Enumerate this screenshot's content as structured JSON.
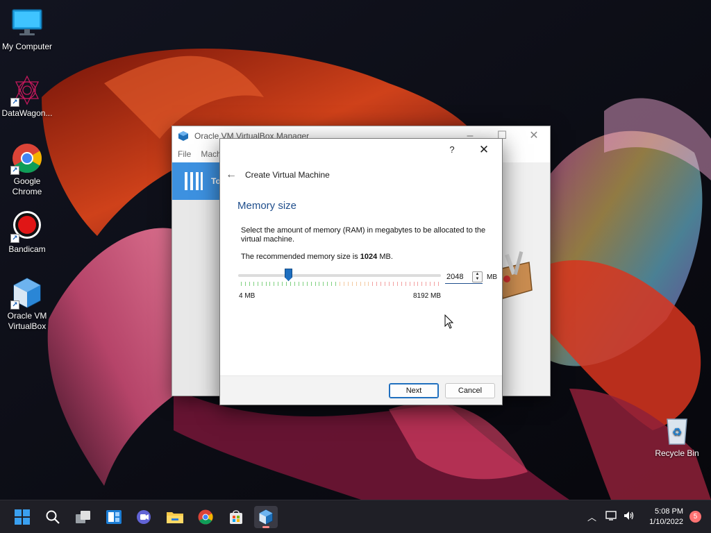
{
  "desktop": {
    "icons": [
      {
        "label": "My Computer"
      },
      {
        "label": "DataWagon..."
      },
      {
        "label": "Google Chrome"
      },
      {
        "label": "Bandicam"
      },
      {
        "label": "Oracle VM VirtualBox"
      },
      {
        "label": "Recycle Bin"
      }
    ]
  },
  "vbox_window": {
    "title": "Oracle VM VirtualBox Manager",
    "menu": [
      "File",
      "Mach"
    ],
    "tools_label": "To"
  },
  "dialog": {
    "wizard_title": "Create Virtual Machine",
    "section_title": "Memory size",
    "description": "Select the amount of memory (RAM) in megabytes to be allocated to the virtual machine.",
    "recommend_prefix": "The recommended memory size is ",
    "recommend_value": "1024",
    "recommend_suffix": " MB.",
    "slider": {
      "min_mb": 4,
      "max_mb": 8192,
      "value_mb": 2048
    },
    "min_label": "4 MB",
    "max_label": "8192 MB",
    "spin_value": "2048",
    "unit": "MB",
    "next_label": "Next",
    "cancel_label": "Cancel",
    "help_label": "?"
  },
  "taskbar": {
    "time": "5:08 PM",
    "date": "1/10/2022",
    "notification_count": "5"
  },
  "colors": {
    "accent": "#1f6fbf",
    "section_title": "#1f4e8c",
    "taskbar": "#1f1f26"
  }
}
